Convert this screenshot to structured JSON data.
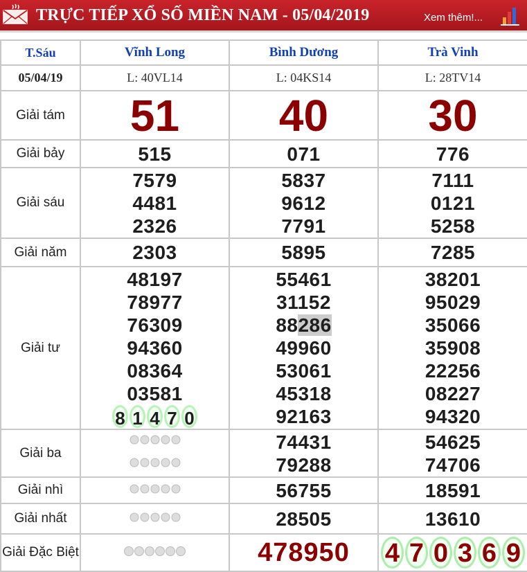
{
  "header": {
    "title": "TRỰC TIẾP XỔ SỐ MIỀN NAM - 05/04/2019",
    "more_link": "Xem thêm!...",
    "left_icon": "mail-icon",
    "right_icon": "bar-chart-icon",
    "bg_color": "#b81d24"
  },
  "table": {
    "day": "T.Sáu",
    "date": "05/04/19",
    "provinces": [
      {
        "name": "Vĩnh Long",
        "code": "L: 40VL14"
      },
      {
        "name": "Bình Dương",
        "code": "L: 04KS14"
      },
      {
        "name": "Trà Vinh",
        "code": "L: 28TV14"
      }
    ],
    "prizes": {
      "g8": {
        "label": "Giải tám",
        "values": [
          "51",
          "40",
          "30"
        ]
      },
      "g7": {
        "label": "Giải bảy",
        "values": [
          "515",
          "071",
          "776"
        ]
      },
      "g6": {
        "label": "Giải sáu",
        "values": [
          [
            "7579",
            "4481",
            "2326"
          ],
          [
            "5837",
            "9612",
            "7791"
          ],
          [
            "7111",
            "0121",
            "5258"
          ]
        ]
      },
      "g5": {
        "label": "Giải năm",
        "values": [
          "2303",
          "5895",
          "7285"
        ]
      },
      "g4": {
        "label": "Giải tư",
        "col1": [
          "48197",
          "78977",
          "76309",
          "94360",
          "08364",
          "03581"
        ],
        "col1_spinning": [
          "8",
          "1",
          "4",
          "7",
          "0"
        ],
        "col2": [
          "55461",
          "31152",
          "88",
          "49960",
          "53061",
          "45318",
          "92163"
        ],
        "col2_highlight": "286",
        "col3": [
          "38201",
          "95029",
          "35066",
          "35908",
          "22256",
          "08227",
          "94320"
        ]
      },
      "g3": {
        "label": "Giải ba",
        "values": [
          [
            "74431",
            "79288"
          ],
          [
            "54625",
            "74706"
          ]
        ]
      },
      "g2": {
        "label": "Giải nhì",
        "values": [
          "56755",
          "18591"
        ]
      },
      "g1": {
        "label": "Giải nhất",
        "values": [
          "28505",
          "13610"
        ]
      },
      "db": {
        "label": "Giải Đặc Biệt",
        "value": "478950",
        "spinning": [
          "4",
          "7",
          "0",
          "3",
          "6",
          "9"
        ]
      }
    }
  },
  "colors": {
    "province_blue": "#1240b3",
    "prize_red": "#8b0000",
    "spin_ring": "#b7f2b7",
    "border_gray": "#c8c8c8"
  }
}
